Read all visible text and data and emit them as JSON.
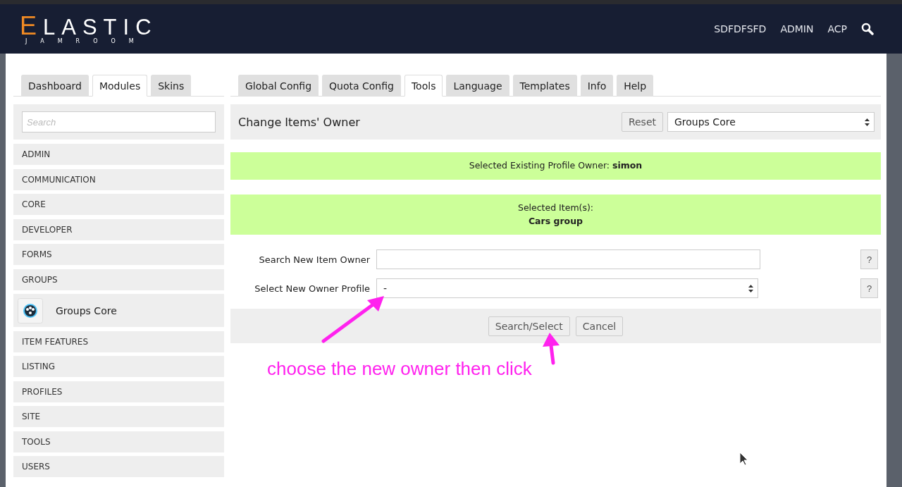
{
  "logo": {
    "initial": "E",
    "rest": "LASTIC",
    "subtitle": "JAMROOM"
  },
  "nav": [
    "SDFDFSFD",
    "ADMIN",
    "ACP"
  ],
  "left_tabs": [
    {
      "label": "Dashboard",
      "selected": false
    },
    {
      "label": "Modules",
      "selected": true
    },
    {
      "label": "Skins",
      "selected": false
    }
  ],
  "right_tabs": [
    {
      "label": "Global Config",
      "selected": false
    },
    {
      "label": "Quota Config",
      "selected": false
    },
    {
      "label": "Tools",
      "selected": true
    },
    {
      "label": "Language",
      "selected": false
    },
    {
      "label": "Templates",
      "selected": false
    },
    {
      "label": "Info",
      "selected": false
    },
    {
      "label": "Help",
      "selected": false
    }
  ],
  "sidebar": {
    "search": {
      "placeholder": "Search"
    },
    "items": [
      {
        "kind": "category",
        "label": "ADMIN"
      },
      {
        "kind": "category",
        "label": "COMMUNICATION"
      },
      {
        "kind": "category",
        "label": "CORE"
      },
      {
        "kind": "category",
        "label": "DEVELOPER"
      },
      {
        "kind": "category",
        "label": "FORMS"
      },
      {
        "kind": "category",
        "label": "GROUPS"
      },
      {
        "kind": "module",
        "label": "Groups Core"
      },
      {
        "kind": "category",
        "label": "ITEM FEATURES"
      },
      {
        "kind": "category",
        "label": "LISTING"
      },
      {
        "kind": "category",
        "label": "PROFILES"
      },
      {
        "kind": "category",
        "label": "SITE"
      },
      {
        "kind": "category",
        "label": "TOOLS"
      },
      {
        "kind": "category",
        "label": "USERS"
      }
    ]
  },
  "panel": {
    "title": "Change Items' Owner",
    "reset": "Reset",
    "module_select": "Groups Core"
  },
  "notices": [
    "Selected Existing Profile Owner: **simon**",
    "Selected Item(s):\n**Cars group**"
  ],
  "form": [
    {
      "kind": "text",
      "label": "Search New Item Owner",
      "help": "?"
    },
    {
      "kind": "select",
      "label": "Select New Owner Profile",
      "value": "-",
      "help": "?"
    }
  ],
  "buttons": [
    "Search/Select",
    "Cancel"
  ],
  "annotation": "choose the new owner then click"
}
